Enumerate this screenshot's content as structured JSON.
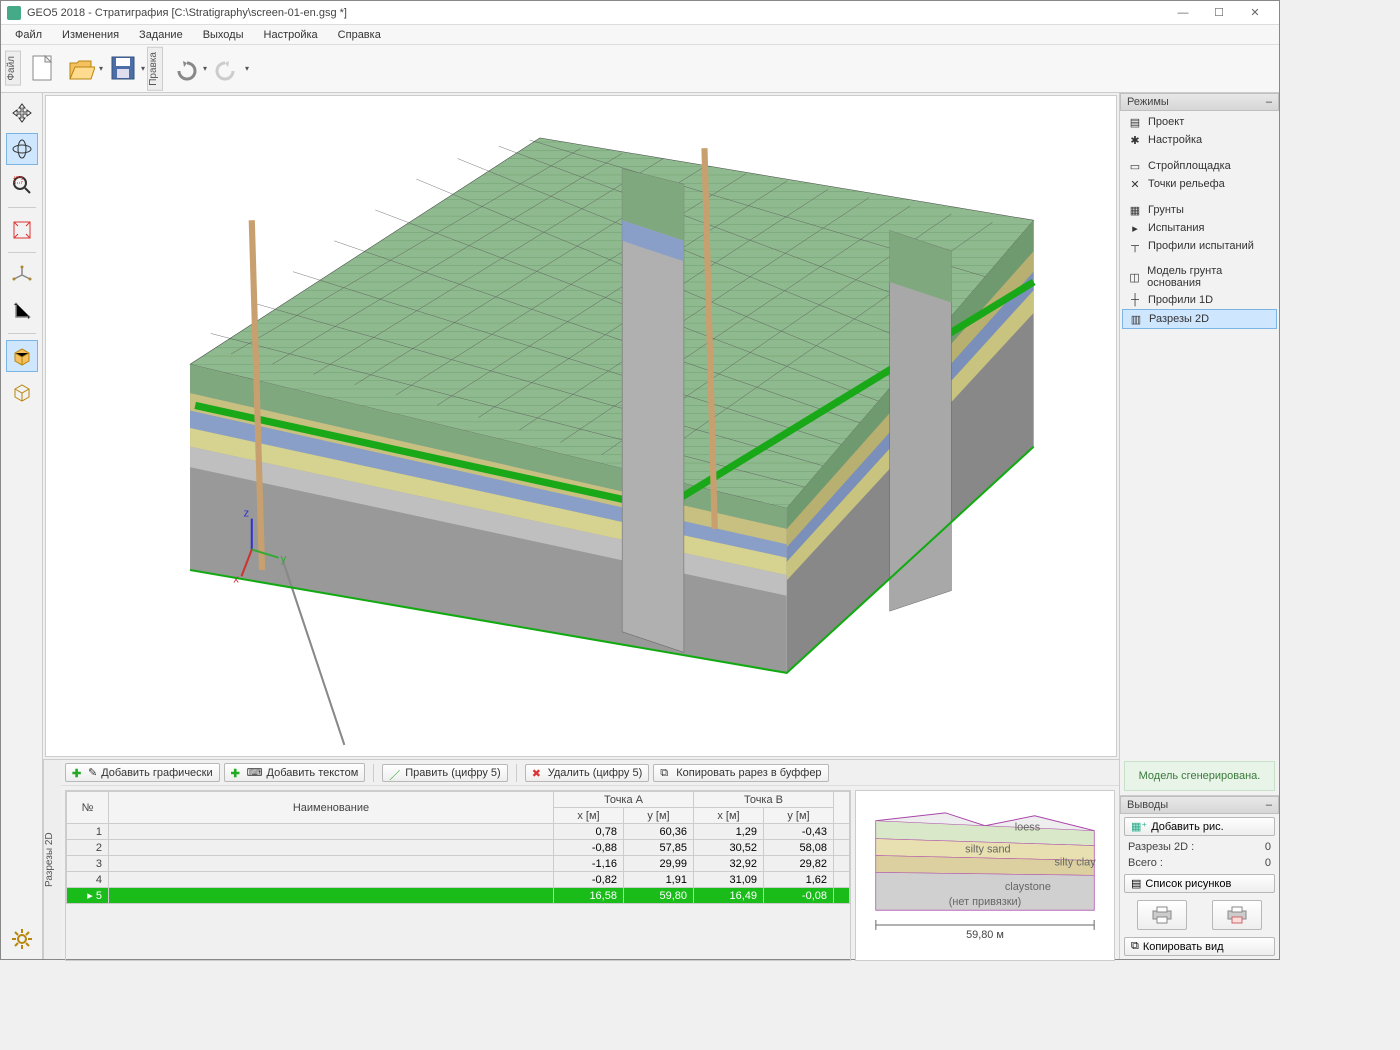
{
  "window": {
    "title": "GEO5 2018 - Стратиграфия [C:\\Stratigraphy\\screen-01-en.gsg *]",
    "min": "—",
    "max": "☐",
    "close": "✕"
  },
  "menu": [
    "Файл",
    "Изменения",
    "Задание",
    "Выходы",
    "Настройка",
    "Справка"
  ],
  "vtabs": {
    "file": "Файл",
    "edit": "Правка",
    "sections": "Разрезы 2D"
  },
  "modes": {
    "header": "Режимы",
    "items": [
      {
        "label": "Проект",
        "icon": "▤"
      },
      {
        "label": "Настройка",
        "icon": "✱"
      },
      {
        "label": "Стройплощадка",
        "icon": "▭"
      },
      {
        "label": "Точки рельефа",
        "icon": "✕"
      },
      {
        "label": "Грунты",
        "icon": "▦"
      },
      {
        "label": "Испытания",
        "icon": "▸"
      },
      {
        "label": "Профили испытаний",
        "icon": "┬"
      },
      {
        "label": "Модель грунта основания",
        "icon": "◫"
      },
      {
        "label": "Профили 1D",
        "icon": "┼"
      },
      {
        "label": "Разрезы 2D",
        "icon": "▥",
        "sel": true
      }
    ],
    "status": "Модель сгенерирована."
  },
  "outputs": {
    "header": "Выводы",
    "add_pic": "Добавить рис.",
    "rows": [
      {
        "label": "Разрезы 2D :",
        "value": "0"
      },
      {
        "label": "Всего :",
        "value": "0"
      }
    ],
    "list": "Список рисунков",
    "copy": "Копировать вид"
  },
  "bottom_toolbar": {
    "add_graphic": "Добавить графически",
    "add_text": "Добавить текстом",
    "edit": "Править (цифру 5)",
    "delete": "Удалить (цифру 5)",
    "copy_buffer": "Копировать рарез в буффер"
  },
  "table": {
    "headers": {
      "no": "№",
      "name": "Наименование",
      "pointA": "Точка A",
      "pointB": "Точка B",
      "x": "x [м]",
      "y": "y [м]"
    },
    "rows": [
      {
        "idx": "1",
        "name": "",
        "ax": "0,78",
        "ay": "60,36",
        "bx": "1,29",
        "by": "-0,43"
      },
      {
        "idx": "2",
        "name": "",
        "ax": "-0,88",
        "ay": "57,85",
        "bx": "30,52",
        "by": "58,08"
      },
      {
        "idx": "3",
        "name": "",
        "ax": "-1,16",
        "ay": "29,99",
        "bx": "32,92",
        "by": "29,82"
      },
      {
        "idx": "4",
        "name": "",
        "ax": "-0,82",
        "ay": "1,91",
        "bx": "31,09",
        "by": "1,62"
      },
      {
        "idx": "5",
        "name": "",
        "ax": "16,58",
        "ay": "59,80",
        "bx": "16,49",
        "by": "-0,08",
        "sel": true
      }
    ]
  },
  "preview": {
    "labels": [
      "loess",
      "silty sand",
      "claystone",
      "silty clay",
      "(нет привязки)"
    ],
    "scale": "59,80 м"
  }
}
